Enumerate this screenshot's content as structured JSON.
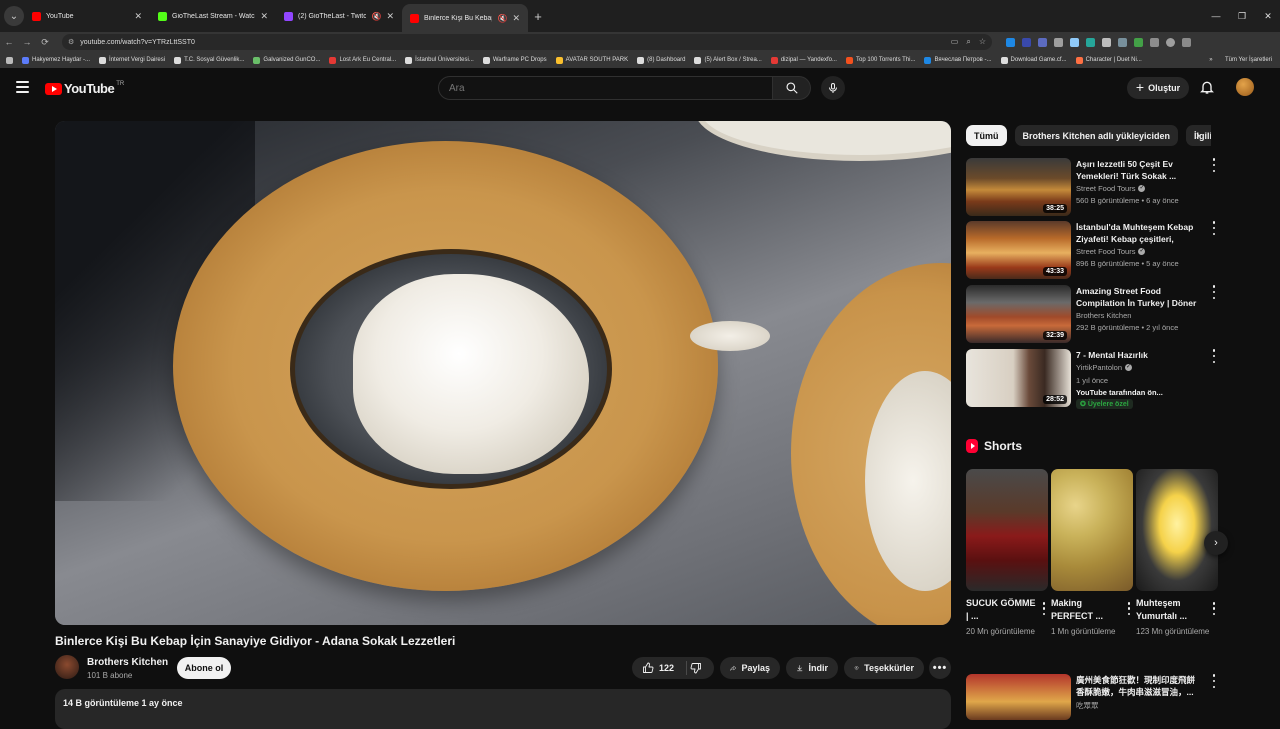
{
  "browser": {
    "tabs": [
      {
        "title": "YouTube",
        "favicon_color": "#ff0000",
        "active": false,
        "muted": false
      },
      {
        "title": "GioTheLast Stream - Watch Live",
        "favicon_color": "#53fc18",
        "active": false,
        "muted": false
      },
      {
        "title": "(2) GioTheLast - Twitch",
        "favicon_color": "#9146ff",
        "active": false,
        "muted": true
      },
      {
        "title": "Binlerce Kişi Bu Kebap İçin",
        "favicon_color": "#ff0000",
        "active": true,
        "muted": true
      }
    ],
    "url": "youtube.com/watch?v=YTRzLttSST0",
    "bookmarks": [
      "Hakyemez Haydar -...",
      "İnternet Vergi Dairesi",
      "T.C. Sosyal Güvenlik...",
      "Galvanized GunCO...",
      "Lost Ark Eu Central...",
      "İstanbul Üniversitesi...",
      "Warframe PC Drops",
      "AVATAR SOUTH PARK",
      "(8) Dashboard",
      "(5) Alert Box / Strea...",
      "dizipal — Yandexfo...",
      "Top 100 Torrents Thi...",
      "Вячеслав Петров -...",
      "Download Game.cf...",
      "Character | Duet Ni..."
    ],
    "all_bookmarks": "Tüm Yer İşaretleri"
  },
  "header": {
    "logo_text": "YouTube",
    "country": "TR",
    "search_placeholder": "Ara",
    "create_label": "Oluştur"
  },
  "video": {
    "title": "Binlerce Kişi Bu Kebap İçin Sanayiye Gidiyor - Adana Sokak Lezzetleri",
    "channel": "Brothers Kitchen",
    "subscribers": "101 B abone",
    "subscribe_label": "Abone ol",
    "likes": "122",
    "share_label": "Paylaş",
    "download_label": "İndir",
    "thanks_label": "Teşekkürler",
    "description_meta": "14 B görüntüleme  1 ay önce"
  },
  "chips": [
    "Tümü",
    "Brothers Kitchen adlı yükleyiciden",
    "İlgili"
  ],
  "recommendations": [
    {
      "title": "Aşırı lezzetli 50 Çeşit Ev Yemekleri! Türk Sokak ...",
      "channel": "Street Food Tours",
      "verified": true,
      "meta": "560 B görüntüleme • 6 ay önce",
      "duration": "38:25"
    },
    {
      "title": "İstanbul'da Muhteşem Kebap Ziyafeti! Kebap çeşitleri, Künef...",
      "channel": "Street Food Tours",
      "verified": true,
      "meta": "896 B görüntüleme • 5 ay önce",
      "duration": "43:33"
    },
    {
      "title": "Amazing Street Food Compilation İn Turkey | Döner ...",
      "channel": "Brothers Kitchen",
      "verified": false,
      "meta": "292 B görüntüleme • 2 yıl önce",
      "duration": "32:39"
    },
    {
      "title": "7 - Mental Hazırlık",
      "channel": "YirtikPantolon",
      "verified": true,
      "meta": "1 yıl önce",
      "meta2": "YouTube tarafından ön...",
      "badge": "Üyelere özel",
      "duration": "28:52"
    }
  ],
  "shorts": {
    "heading": "Shorts",
    "items": [
      {
        "title": "SUCUK GÖMME | ...",
        "views": "20 Mn görüntüleme"
      },
      {
        "title": "Making PERFECT ...",
        "views": "1 Mn görüntüleme"
      },
      {
        "title": "Muhteşem Yumurtalı ...",
        "views": "123 Mn görüntüleme"
      }
    ]
  },
  "bottom_rec": {
    "title": "廣州美食節狂歡！現制印度飛餅 香酥脆嫩，牛肉串滋滋冒油，...",
    "channel": "吃眾眾"
  },
  "colors": {
    "brand_red": "#ff0000",
    "background": "#0f0f0f",
    "member_green": "#2ba640"
  }
}
